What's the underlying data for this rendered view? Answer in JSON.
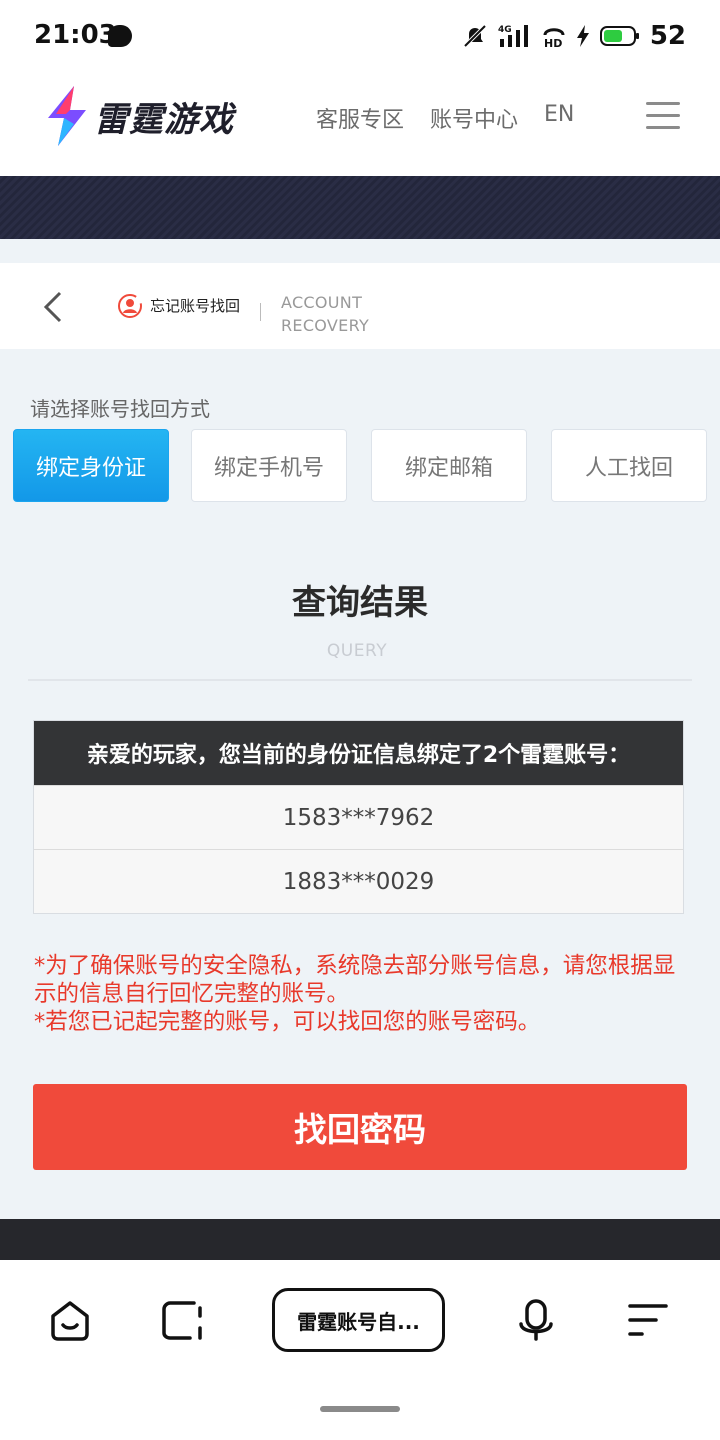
{
  "status_bar": {
    "time": "21:03",
    "battery": "52",
    "icons": [
      "chat-bubble-icon",
      "bell-muted-icon",
      "signal-4g-icon",
      "hd-voice-icon",
      "charging-icon",
      "battery-icon"
    ]
  },
  "header": {
    "logo_text": "雷霆游戏",
    "nav": [
      "客服专区",
      "账号中心",
      "EN"
    ],
    "menu_icon": "hamburger-menu-icon"
  },
  "subheader": {
    "title": "忘记账号找回",
    "en_line1": "ACCOUNT",
    "en_line2": "RECOVERY"
  },
  "main": {
    "choose_label": "请选择账号找回方式",
    "methods": [
      {
        "label": "绑定身份证",
        "active": true
      },
      {
        "label": "绑定手机号",
        "active": false
      },
      {
        "label": "绑定邮箱",
        "active": false
      },
      {
        "label": "人工找回",
        "active": false
      }
    ],
    "result_title": "查询结果",
    "result_sub": "QUERY",
    "table_header": "亲爱的玩家，您当前的身份证信息绑定了2个雷霆账号：",
    "accounts": [
      "1583***7962",
      "1883***0029"
    ],
    "notes": [
      "*为了确保账号的安全隐私，系统隐去部分账号信息，请您根据显示的信息自行回忆完整的账号。",
      "*若您已记起完整的账号，可以找回您的账号密码。"
    ],
    "recover_button": "找回密码"
  },
  "browser_bar": {
    "address": "雷霆账号自...",
    "icons": [
      "home-icon",
      "tabs-icon",
      "microphone-icon",
      "menu-lines-icon"
    ]
  },
  "colors": {
    "accent_blue": "#1ba5ef",
    "accent_red": "#f04a3b",
    "notes_red": "#e8392b",
    "page_bg": "#eef3f7"
  }
}
